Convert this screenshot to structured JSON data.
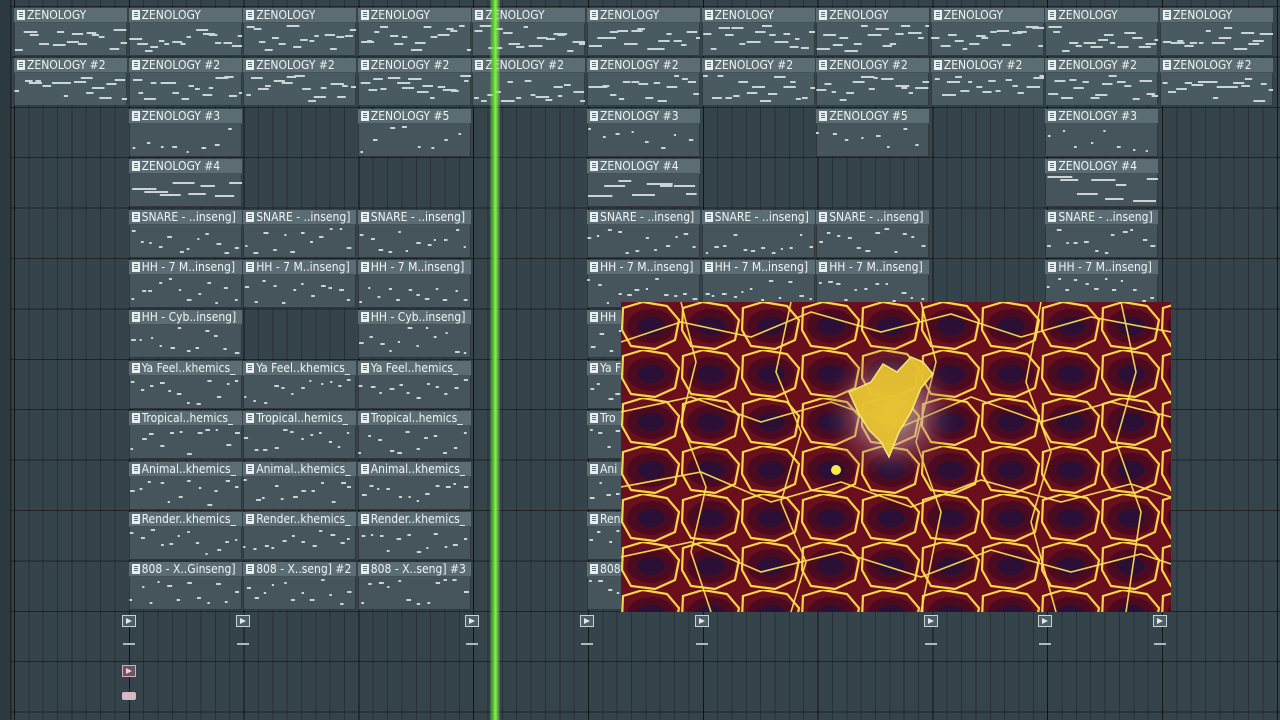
{
  "playlist": {
    "tracks": [
      {
        "clips": [
          {
            "name": "ZENOLOGY",
            "start": 0
          },
          {
            "name": "ZENOLOGY",
            "start": 1
          },
          {
            "name": "ZENOLOGY",
            "start": 2
          },
          {
            "name": "ZENOLOGY",
            "start": 3
          },
          {
            "name": "ZENOLOGY",
            "start": 4
          },
          {
            "name": "ZENOLOGY",
            "start": 5
          },
          {
            "name": "ZENOLOGY",
            "start": 6
          },
          {
            "name": "ZENOLOGY",
            "start": 7
          },
          {
            "name": "ZENOLOGY",
            "start": 8
          },
          {
            "name": "ZENOLOGY",
            "start": 9
          },
          {
            "name": "ZENOLOGY",
            "start": 10
          }
        ]
      },
      {
        "clips": [
          {
            "name": "ZENOLOGY #2",
            "start": 0
          },
          {
            "name": "ZENOLOGY #2",
            "start": 1
          },
          {
            "name": "ZENOLOGY #2",
            "start": 2
          },
          {
            "name": "ZENOLOGY #2",
            "start": 3
          },
          {
            "name": "ZENOLOGY #2",
            "start": 4
          },
          {
            "name": "ZENOLOGY #2",
            "start": 5
          },
          {
            "name": "ZENOLOGY #2",
            "start": 6
          },
          {
            "name": "ZENOLOGY #2",
            "start": 7
          },
          {
            "name": "ZENOLOGY #2",
            "start": 8
          },
          {
            "name": "ZENOLOGY #2",
            "start": 9
          },
          {
            "name": "ZENOLOGY #2",
            "start": 10
          }
        ]
      },
      {
        "clips": [
          {
            "name": "ZENOLOGY #3",
            "start": 1
          },
          {
            "name": "ZENOLOGY #5",
            "start": 3
          },
          {
            "name": "ZENOLOGY #3",
            "start": 5
          },
          {
            "name": "ZENOLOGY #5",
            "start": 7
          },
          {
            "name": "ZENOLOGY #3",
            "start": 9
          }
        ]
      },
      {
        "clips": [
          {
            "name": "ZENOLOGY #4",
            "start": 1
          },
          {
            "name": "ZENOLOGY #4",
            "start": 5
          },
          {
            "name": "ZENOLOGY #4",
            "start": 9
          }
        ]
      },
      {
        "clips": [
          {
            "name": "SNARE - ..inseng]",
            "start": 1
          },
          {
            "name": "SNARE - ..inseng]",
            "start": 2
          },
          {
            "name": "SNARE - ..inseng]",
            "start": 3
          },
          {
            "name": "SNARE - ..inseng]",
            "start": 5
          },
          {
            "name": "SNARE - ..inseng]",
            "start": 6
          },
          {
            "name": "SNARE - ..inseng]",
            "start": 7
          },
          {
            "name": "SNARE - ..inseng]",
            "start": 9
          }
        ]
      },
      {
        "clips": [
          {
            "name": "HH - 7 M..inseng]",
            "start": 1
          },
          {
            "name": "HH - 7 M..inseng]",
            "start": 2
          },
          {
            "name": "HH - 7 M..inseng]",
            "start": 3
          },
          {
            "name": "HH - 7 M..inseng]",
            "start": 5
          },
          {
            "name": "HH - 7 M..inseng]",
            "start": 6
          },
          {
            "name": "HH - 7 M..inseng]",
            "start": 7
          },
          {
            "name": "HH - 7 M..inseng]",
            "start": 9
          }
        ]
      },
      {
        "clips": [
          {
            "name": "HH - Cyb..inseng]",
            "start": 1
          },
          {
            "name": "HH - Cyb..inseng]",
            "start": 3
          },
          {
            "name": "HH",
            "start": 5
          }
        ]
      },
      {
        "clips": [
          {
            "name": "Ya Feel..khemics_",
            "start": 1
          },
          {
            "name": "Ya Feel..khemics_",
            "start": 2
          },
          {
            "name": "Ya Feel..hemics_",
            "start": 3
          },
          {
            "name": "Ya F",
            "start": 5
          }
        ]
      },
      {
        "clips": [
          {
            "name": "Tropical..hemics_",
            "start": 1
          },
          {
            "name": "Tropical..hemics_",
            "start": 2
          },
          {
            "name": "Tropical..hemics_",
            "start": 3
          },
          {
            "name": "Tro",
            "start": 5
          }
        ]
      },
      {
        "clips": [
          {
            "name": "Animal..khemics_",
            "start": 1
          },
          {
            "name": "Animal..khemics_",
            "start": 2
          },
          {
            "name": "Animal..khemics_",
            "start": 3
          },
          {
            "name": "Ani",
            "start": 5
          }
        ]
      },
      {
        "clips": [
          {
            "name": "Render..khemics_",
            "start": 1
          },
          {
            "name": "Render..khemics_",
            "start": 2
          },
          {
            "name": "Render..khemics_",
            "start": 3
          },
          {
            "name": "Ren",
            "start": 5
          }
        ]
      },
      {
        "clips": [
          {
            "name": "808 - X..Ginseng]",
            "start": 1
          },
          {
            "name": "808 - X..seng] #2",
            "start": 2
          },
          {
            "name": "808 - X..seng] #3",
            "start": 3
          },
          {
            "name": "808",
            "start": 5
          }
        ]
      }
    ],
    "markers": [
      1,
      2,
      4,
      5,
      6,
      8,
      9,
      10
    ],
    "playhead_bar": 4.2
  },
  "colors": {
    "playhead": "#5fd631",
    "clip_header": "#5b6c73",
    "clip_body": "#4a5a61",
    "background": "#35444b"
  },
  "icons": [
    "pattern-icon",
    "marker-icon",
    "automation-icon"
  ]
}
